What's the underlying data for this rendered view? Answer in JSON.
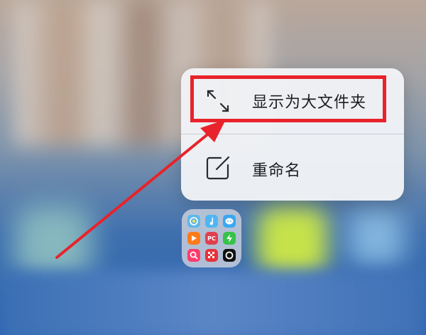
{
  "menu": {
    "items": [
      {
        "label": "显示为大文件夹",
        "icon": "expand-arrows-icon"
      },
      {
        "label": "重命名",
        "icon": "rename-edit-icon"
      }
    ]
  },
  "folder": {
    "apps": [
      {
        "icon": "browser-app-icon",
        "color": "#5fb9e8"
      },
      {
        "icon": "music-app-icon",
        "color": "#4fb6f2"
      },
      {
        "icon": "message-app-icon",
        "color": "#3aa8f0"
      },
      {
        "icon": "video-play-app-icon",
        "color": "#ff7a18"
      },
      {
        "icon": "pc-app-icon",
        "color": "#e04050",
        "text": "PC"
      },
      {
        "icon": "bolt-app-icon",
        "color": "#37c24a"
      },
      {
        "icon": "magnifier-app-icon",
        "color": "#ff3b6b"
      },
      {
        "icon": "checker-app-icon",
        "color": "#e8323a"
      },
      {
        "icon": "camera-ring-app-icon",
        "color": "#111111"
      }
    ]
  },
  "colors": {
    "highlight": "#e8232b",
    "arrow": "#e8232b",
    "menu_bg": "#f0f2f6"
  }
}
